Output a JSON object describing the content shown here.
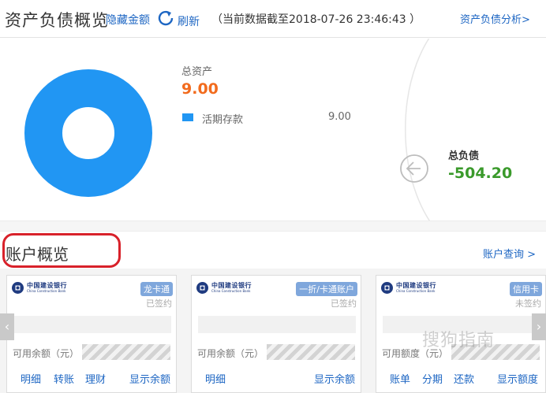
{
  "header": {
    "title": "资产负债概览",
    "hide_amount": "隐藏金额",
    "refresh": "刷新",
    "timestamp": "（当前数据截至2018-07-26 23:46:43 ）",
    "analysis_link": "资产负债分析>"
  },
  "assets": {
    "label": "总资产",
    "value": "9.00",
    "legend": [
      {
        "label": "活期存款",
        "value": "9.00",
        "color": "#2196f3"
      }
    ]
  },
  "debt": {
    "label": "总负债",
    "value": "-504.20"
  },
  "accounts": {
    "title": "账户概览",
    "query_link": "账户查询 >",
    "cards": [
      {
        "bank_cn": "中国建设银行",
        "bank_en": "China Construction Bank",
        "badge": "龙卡通",
        "status": "已签约",
        "balance_label": "可用余额（元）",
        "actions": [
          "明细",
          "转账",
          "理财",
          "显示余额"
        ]
      },
      {
        "bank_cn": "中国建设银行",
        "bank_en": "China Construction Bank",
        "badge": "一折/卡通账户",
        "status": "已签约",
        "balance_label": "可用余额（元）",
        "actions": [
          "明细",
          "显示余额"
        ]
      },
      {
        "bank_cn": "中国建设银行",
        "bank_en": "China Construction Bank",
        "badge": "信用卡",
        "status": "未签约",
        "balance_label": "可用额度（元）",
        "actions": [
          "账单",
          "分期",
          "还款",
          "显示额度"
        ]
      }
    ]
  },
  "nav": {
    "prev": "‹",
    "next": "›"
  },
  "watermark": "搜狗指南",
  "colors": {
    "link": "#1d66c3",
    "assets": "#f26b1d",
    "debt": "#3a9a2b",
    "donut": "#2196f3",
    "highlight": "#d8212a"
  }
}
